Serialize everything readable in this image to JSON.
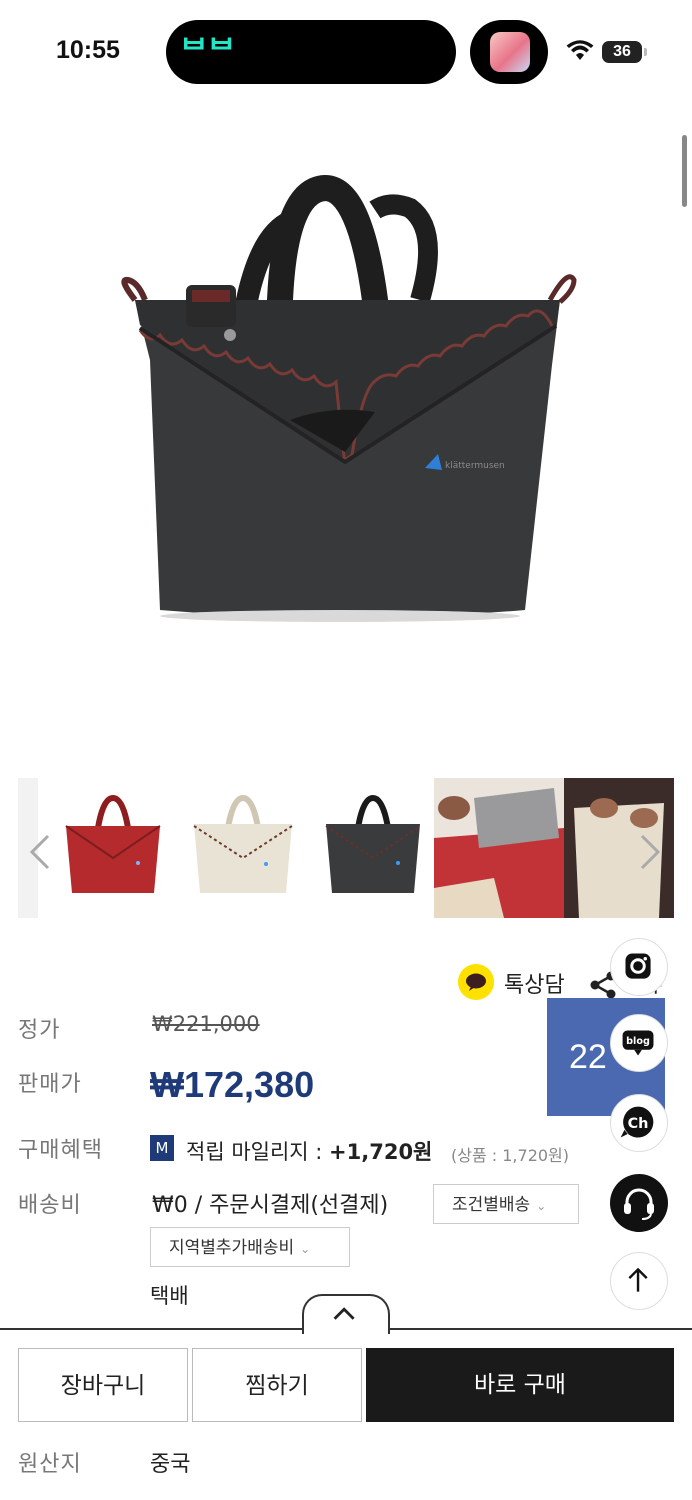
{
  "status_bar": {
    "time": "10:55",
    "battery": "36",
    "island_app_glyph": "ᄇᄇ"
  },
  "product": {
    "thumbnails": [
      {
        "color_name": "red",
        "color": "#b52a2c"
      },
      {
        "color_name": "cream",
        "color": "#e9e3d6"
      },
      {
        "color_name": "black",
        "color": "#3a3b3d"
      },
      {
        "color_name": "lifestyle-red-interior",
        "color": "#c23338"
      },
      {
        "color_name": "lifestyle-cream-open",
        "color": "#e6ddcc"
      }
    ]
  },
  "share": {
    "kakao_label": "톡상담",
    "share_label": "공유"
  },
  "price": {
    "list_price_label": "정가",
    "list_price": "₩221,000",
    "sale_price_label": "판매가",
    "sale_price": "₩172,380",
    "benefit_label": "구매혜택",
    "mileage_badge": "M",
    "mileage_text": "적립 마일리지 : ",
    "mileage_value": "+1,720원",
    "mileage_sub": "(상품 : 1,720원)",
    "shipping_label": "배송비",
    "shipping_fee": "₩0  / 주문시결제(선결제)",
    "shipping_condition": "조건별배송",
    "regional_shipping": "지역별추가배송비",
    "shipping_method": "택배",
    "origin_label": "원산지",
    "origin_value": "중국"
  },
  "promo_banner": {
    "text": "22"
  },
  "floating": {
    "blog_label": "blog",
    "channel_label": "Ch"
  },
  "actions": {
    "cart_label": "장바구니",
    "wish_label": "찜하기",
    "buy_label": "바로 구매"
  }
}
